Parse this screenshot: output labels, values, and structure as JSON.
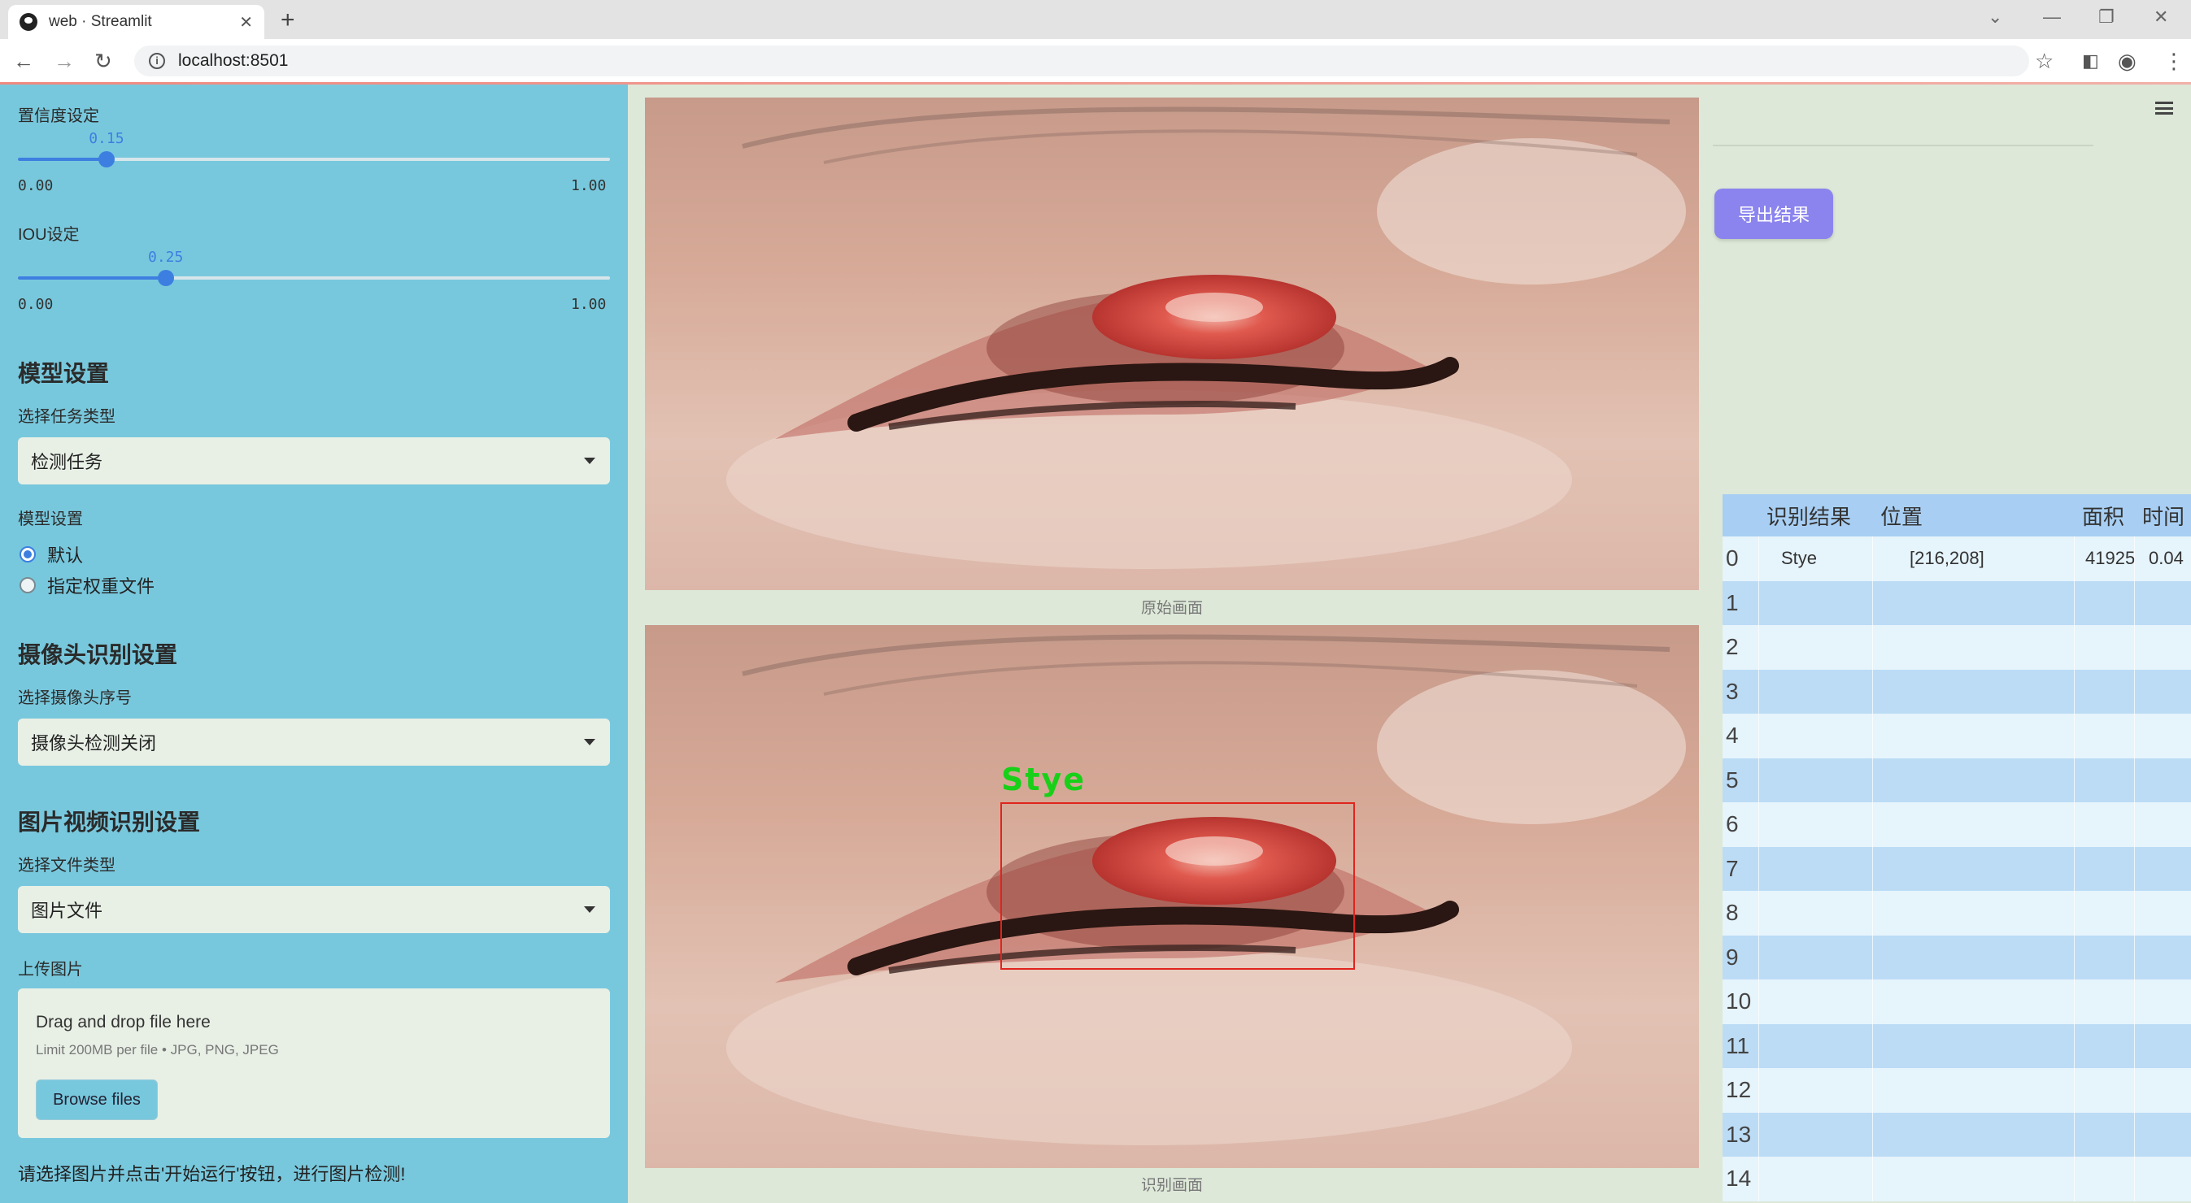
{
  "browser": {
    "tab_title": "web · Streamlit",
    "url": "localhost:8501"
  },
  "sidebar": {
    "confidence": {
      "label": "置信度设定",
      "value": "0.15",
      "min": "0.00",
      "max": "1.00",
      "fraction": 0.15
    },
    "iou": {
      "label": "IOU设定",
      "value": "0.25",
      "min": "0.00",
      "max": "1.00",
      "fraction": 0.25
    },
    "model_heading": "模型设置",
    "task_label": "选择任务类型",
    "task_value": "检测任务",
    "model_label": "模型设置",
    "model_options": [
      "默认",
      "指定权重文件"
    ],
    "camera_heading": "摄像头识别设置",
    "camera_label": "选择摄像头序号",
    "camera_value": "摄像头检测关闭",
    "media_heading": "图片视频识别设置",
    "filetype_label": "选择文件类型",
    "filetype_value": "图片文件",
    "upload_label": "上传图片",
    "upload_title": "Drag and drop file here",
    "upload_limit": "Limit 200MB per file • JPG, PNG, JPEG",
    "browse_label": "Browse files",
    "hint": "请选择图片并点击'开始运行'按钮，进行图片检测!"
  },
  "main": {
    "original_caption": "原始画面",
    "result_caption": "识别画面",
    "detection_label": "Stye"
  },
  "results": {
    "export_label": "导出结果",
    "columns": [
      "识别结果",
      "位置",
      "面积",
      "时间"
    ],
    "rows": [
      {
        "idx": "0",
        "result": "Stye",
        "position": "[216,208]",
        "area": "41925",
        "time": "0.04"
      },
      {
        "idx": "1"
      },
      {
        "idx": "2"
      },
      {
        "idx": "3"
      },
      {
        "idx": "4"
      },
      {
        "idx": "5"
      },
      {
        "idx": "6"
      },
      {
        "idx": "7"
      },
      {
        "idx": "8"
      },
      {
        "idx": "9"
      },
      {
        "idx": "10"
      },
      {
        "idx": "11"
      },
      {
        "idx": "12"
      },
      {
        "idx": "13"
      },
      {
        "idx": "14"
      }
    ]
  },
  "colors": {
    "sidebar_bg": "#78c8dd",
    "accent": "#3d7fe0",
    "export_button": "#8b84ee",
    "table_header": "#a8cff3",
    "row_even": "#e6f4fb",
    "row_odd": "#bcdcf6",
    "detect_box": "#e0241e",
    "detect_text": "#18d018"
  }
}
